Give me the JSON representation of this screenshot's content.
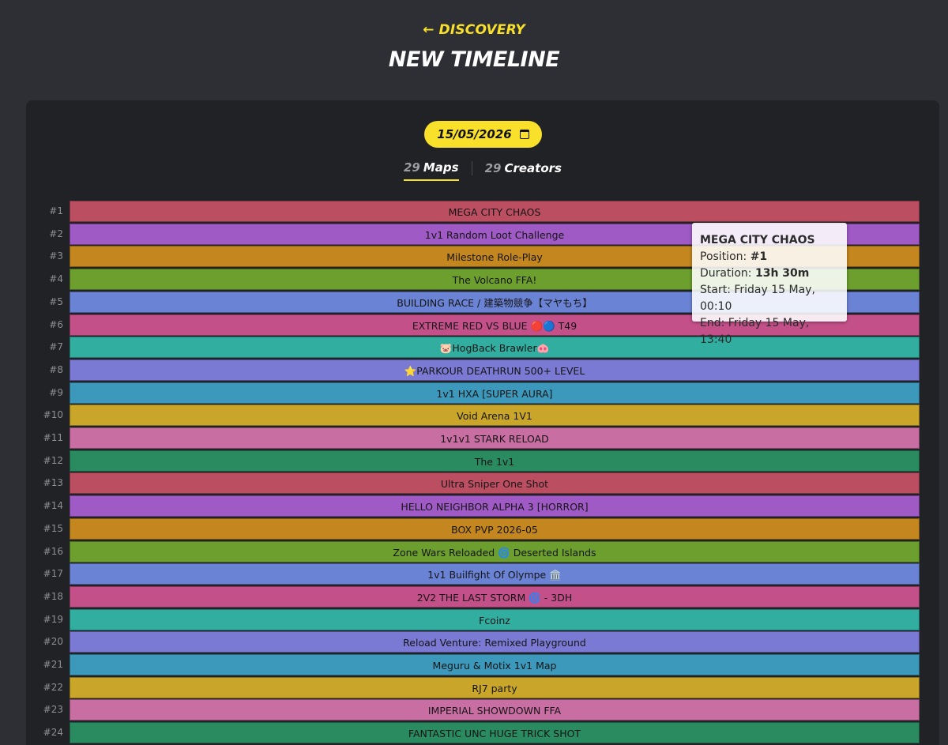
{
  "header": {
    "back_label": "DISCOVERY",
    "title": "NEW TIMELINE"
  },
  "date_picker": {
    "value": "15/05/2026"
  },
  "tabs": [
    {
      "count": "29",
      "label": "Maps",
      "active": true
    },
    {
      "count": "29",
      "label": "Creators",
      "active": false
    }
  ],
  "rows": [
    {
      "rank": "#1",
      "name": "MEGA CITY CHAOS",
      "color": "#bc4e62"
    },
    {
      "rank": "#2",
      "name": "1v1 Random Loot Challenge",
      "color": "#9f5ac6"
    },
    {
      "rank": "#3",
      "name": "Milestone Role-Play",
      "color": "#c4861e"
    },
    {
      "rank": "#4",
      "name": "The Volcano FFA!",
      "color": "#6c9f2e"
    },
    {
      "rank": "#5",
      "name": "BUILDING RACE / 建築物競争【マヤもち】",
      "color": "#6b83d5"
    },
    {
      "rank": "#6",
      "name": "EXTREME RED VS BLUE 🔴🔵 T49",
      "color": "#c4508a"
    },
    {
      "rank": "#7",
      "name": "🐷HogBack Brawler🐽",
      "color": "#32aea1"
    },
    {
      "rank": "#8",
      "name": "⭐PARKOUR DEATHRUN 500+ LEVEL",
      "color": "#7a79d4"
    },
    {
      "rank": "#9",
      "name": "1v1 HXA [SUPER AURA]",
      "color": "#3c99bb"
    },
    {
      "rank": "#10",
      "name": "Void Arena 1V1",
      "color": "#c9a629"
    },
    {
      "rank": "#11",
      "name": "1v1v1 STARK RELOAD",
      "color": "#c96ea2"
    },
    {
      "rank": "#12",
      "name": "The 1v1",
      "color": "#2a8a60"
    },
    {
      "rank": "#13",
      "name": "Ultra Sniper One Shot",
      "color": "#bc4e62"
    },
    {
      "rank": "#14",
      "name": "HELLO NEIGHBOR ALPHA 3 [HORROR]",
      "color": "#9f5ac6"
    },
    {
      "rank": "#15",
      "name": "BOX PVP 2026-05",
      "color": "#c4861e"
    },
    {
      "rank": "#16",
      "name": "Zone Wars Reloaded 🌀 Deserted Islands",
      "color": "#6c9f2e"
    },
    {
      "rank": "#17",
      "name": "1v1 Builfight Of Olympe 🏛️",
      "color": "#6b83d5"
    },
    {
      "rank": "#18",
      "name": "2V2 THE LAST STORM 🌀 - 3DH",
      "color": "#c4508a"
    },
    {
      "rank": "#19",
      "name": "Fcoinz",
      "color": "#32aea1"
    },
    {
      "rank": "#20",
      "name": "Reload Venture: Remixed Playground",
      "color": "#7a79d4"
    },
    {
      "rank": "#21",
      "name": "Meguru & Motix 1v1 Map",
      "color": "#3c99bb"
    },
    {
      "rank": "#22",
      "name": "RJ7 party",
      "color": "#c9a629"
    },
    {
      "rank": "#23",
      "name": "IMPERIAL SHOWDOWN FFA",
      "color": "#c96ea2"
    },
    {
      "rank": "#24",
      "name": "FANTASTIC UNC HUGE TRICK SHOT",
      "color": "#2a8a60"
    }
  ],
  "tooltip": {
    "title": "MEGA CITY CHAOS",
    "position_label": "Position: ",
    "position_value": "#1",
    "duration_label": "Duration: ",
    "duration_value": "13h 30m",
    "start": "Start: Friday 15 May, 00:10",
    "end": "End: Friday 15 May, 13:40"
  }
}
